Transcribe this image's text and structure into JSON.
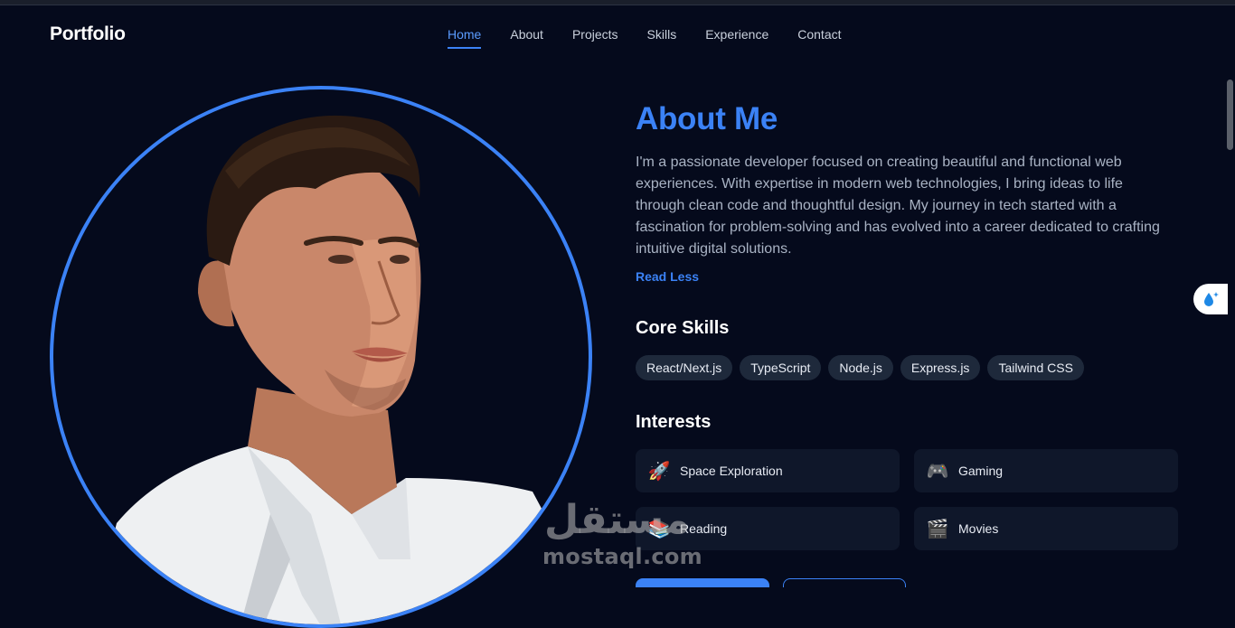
{
  "navbar": {
    "logo": "Portfolio",
    "links": [
      "Home",
      "About",
      "Projects",
      "Skills",
      "Experience",
      "Contact"
    ],
    "active": "Home"
  },
  "about": {
    "title": "About Me",
    "bio": "I'm a passionate developer focused on creating beautiful and functional web experiences. With expertise in modern web technologies, I bring ideas to life through clean code and thoughtful design. My journey in tech started with a fascination for problem-solving and has evolved into a career dedicated to crafting intuitive digital solutions.",
    "toggle_label": "Read Less"
  },
  "skills": {
    "title": "Core Skills",
    "items": [
      "React/Next.js",
      "TypeScript",
      "Node.js",
      "Express.js",
      "Tailwind CSS"
    ]
  },
  "interests": {
    "title": "Interests",
    "items": [
      {
        "emoji": "🚀",
        "icon": "rocket-icon",
        "label": "Space Exploration"
      },
      {
        "emoji": "🎮",
        "icon": "gamepad-icon",
        "label": "Gaming"
      },
      {
        "emoji": "📚",
        "icon": "books-icon",
        "label": "Reading"
      },
      {
        "emoji": "🎬",
        "icon": "clapperboard-icon",
        "label": "Movies"
      }
    ]
  },
  "watermark": {
    "arabic": "مستقل",
    "latin": "mostaql.com"
  },
  "colors": {
    "background": "#050a1c",
    "accent": "#3b82f6",
    "chip_bg": "#1e293b",
    "card_bg": "#0f172a"
  }
}
